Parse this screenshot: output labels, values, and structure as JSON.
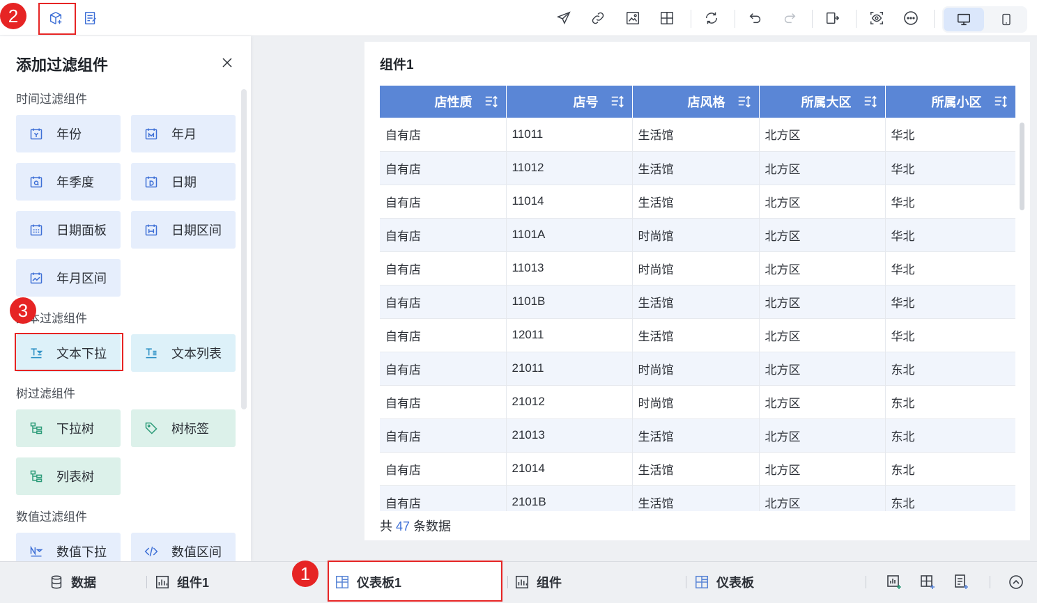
{
  "toolbar": {
    "icons": [
      "add-filter-component-icon",
      "edit-list-icon",
      "send-icon",
      "link-icon",
      "image-export-icon",
      "grid-icon",
      "refresh-icon",
      "undo-icon",
      "redo-icon",
      "exit-icon",
      "preview-icon",
      "more-icon",
      "desktop-icon",
      "mobile-icon"
    ],
    "active_device": "desktop"
  },
  "markers": {
    "m1": "1",
    "m2": "2",
    "m3": "3"
  },
  "panel": {
    "title": "添加过滤组件",
    "sections": {
      "time": {
        "title": "时间过滤组件",
        "items": [
          "年份",
          "年月",
          "年季度",
          "日期",
          "日期面板",
          "日期区间",
          "年月区间"
        ]
      },
      "text": {
        "title": "文本过滤组件",
        "items": [
          "文本下拉",
          "文本列表"
        ]
      },
      "tree": {
        "title": "树过滤组件",
        "items": [
          "下拉树",
          "树标签",
          "列表树"
        ]
      },
      "number": {
        "title": "数值过滤组件",
        "items": [
          "数值下拉",
          "数值区间"
        ]
      }
    }
  },
  "card": {
    "title": "组件1",
    "columns": [
      "店性质",
      "店号",
      "店风格",
      "所属大区",
      "所属小区"
    ],
    "rows": [
      [
        "自有店",
        "11011",
        "生活馆",
        "北方区",
        "华北"
      ],
      [
        "自有店",
        "11012",
        "生活馆",
        "北方区",
        "华北"
      ],
      [
        "自有店",
        "11014",
        "生活馆",
        "北方区",
        "华北"
      ],
      [
        "自有店",
        "1101A",
        "时尚馆",
        "北方区",
        "华北"
      ],
      [
        "自有店",
        "11013",
        "时尚馆",
        "北方区",
        "华北"
      ],
      [
        "自有店",
        "1101B",
        "生活馆",
        "北方区",
        "华北"
      ],
      [
        "自有店",
        "12011",
        "生活馆",
        "北方区",
        "华北"
      ],
      [
        "自有店",
        "21011",
        "时尚馆",
        "北方区",
        "东北"
      ],
      [
        "自有店",
        "21012",
        "时尚馆",
        "北方区",
        "东北"
      ],
      [
        "自有店",
        "21013",
        "生活馆",
        "北方区",
        "东北"
      ],
      [
        "自有店",
        "21014",
        "生活馆",
        "北方区",
        "东北"
      ],
      [
        "自有店",
        "2101B",
        "生活馆",
        "北方区",
        "东北"
      ]
    ],
    "footer": {
      "prefix": "共",
      "count": "47",
      "suffix": "条数据"
    }
  },
  "bottom_tabs": {
    "data": "数据",
    "component1": "组件1",
    "dashboard1": "仪表板1",
    "component": "组件",
    "dashboard": "仪表板"
  },
  "colors": {
    "accent": "#5a86d6",
    "marker_red": "#e62424",
    "link_blue": "#3d6fd6"
  }
}
